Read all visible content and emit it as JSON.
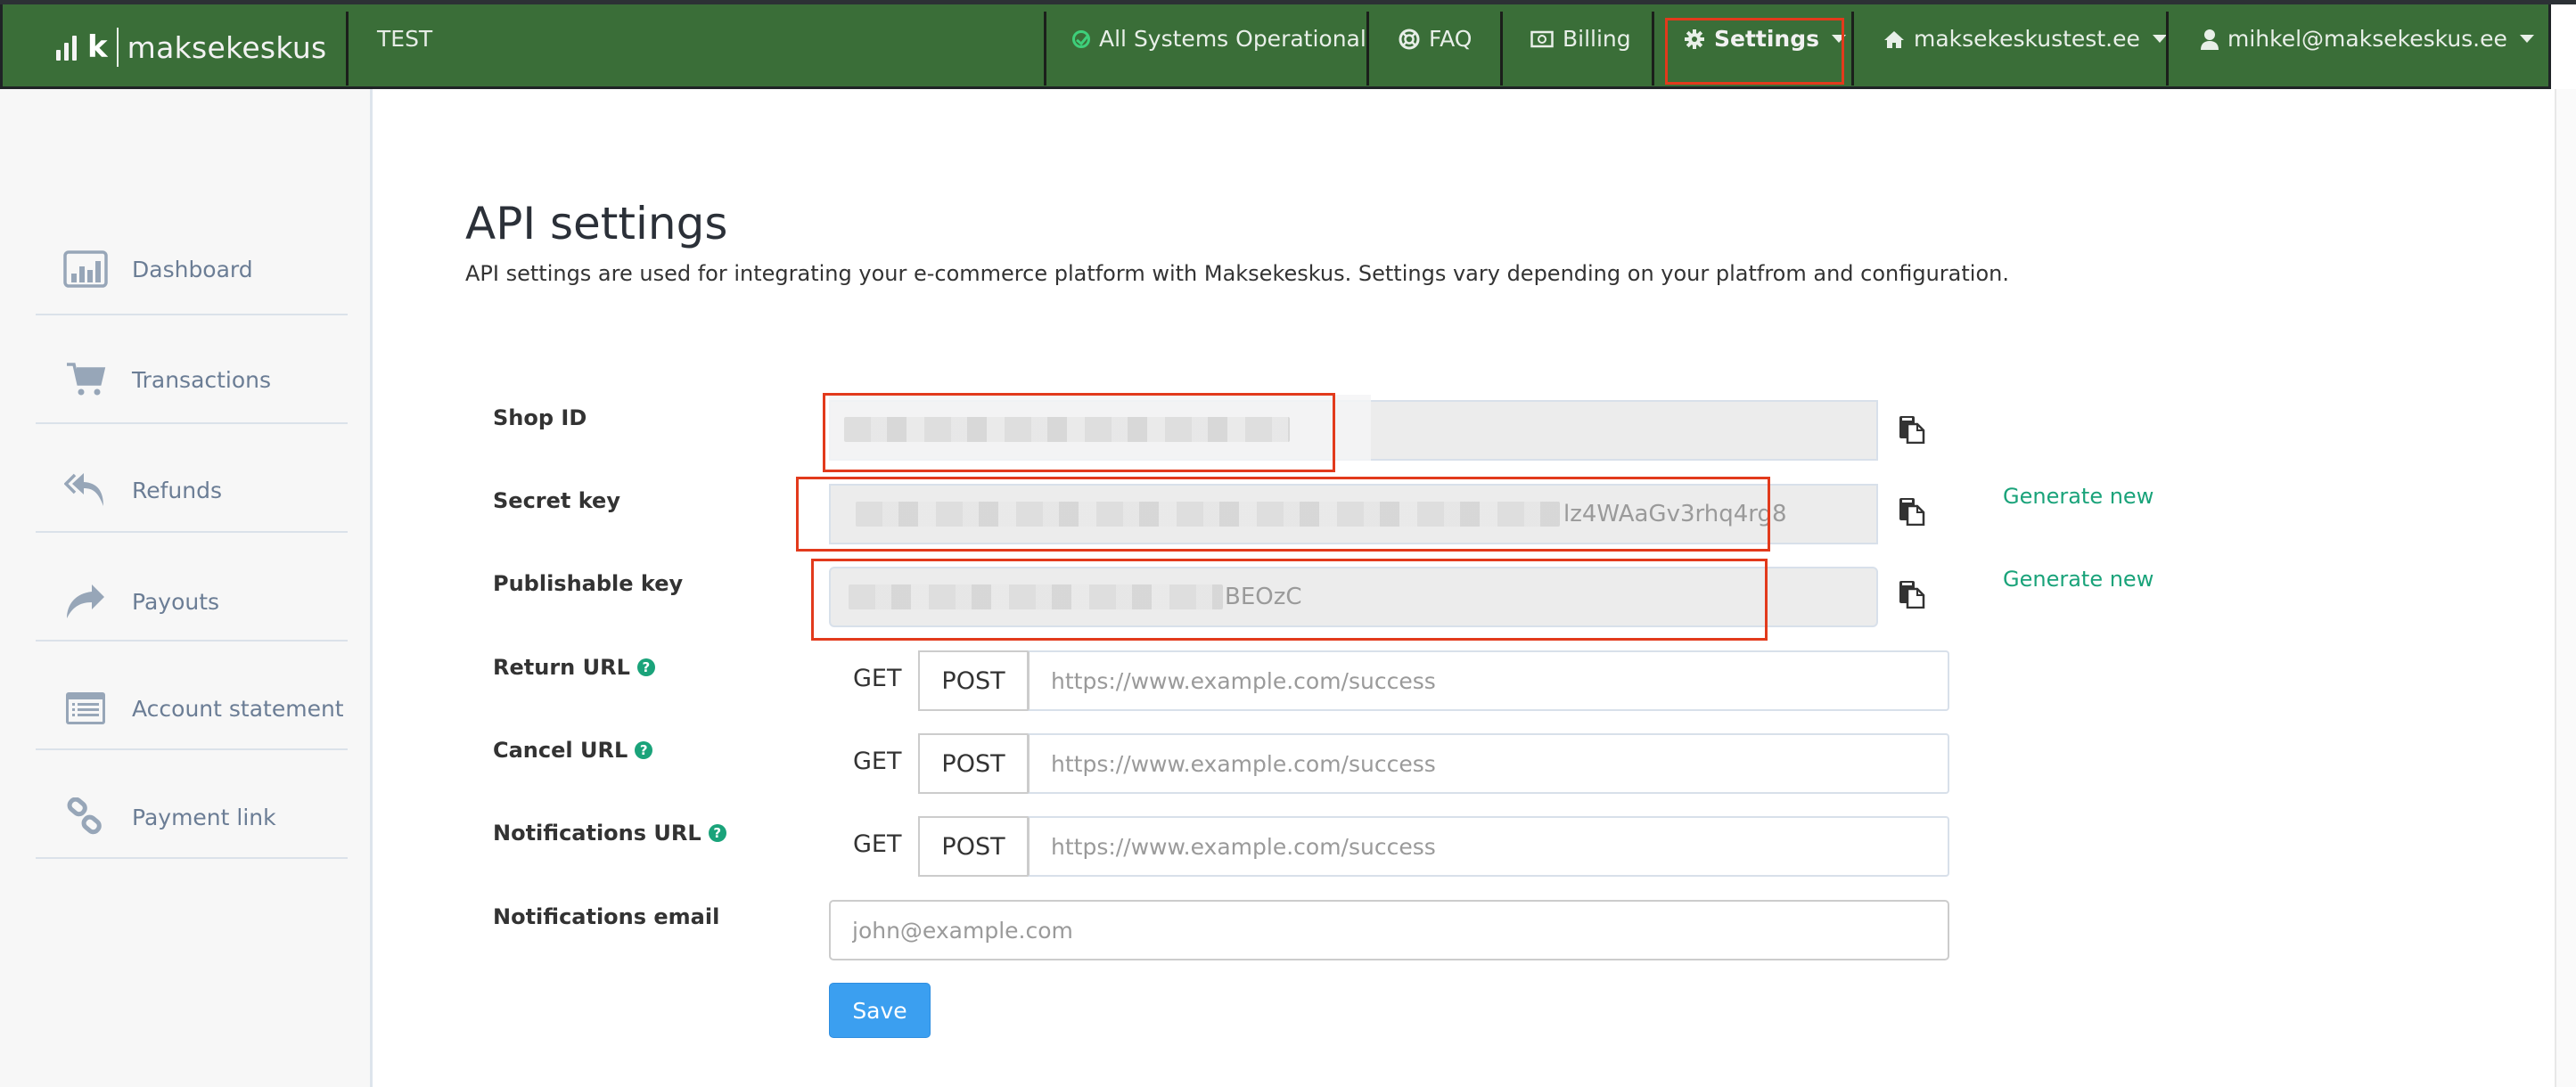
{
  "header": {
    "brand": "maksekeskus",
    "environment": "TEST",
    "status": "All Systems Operational",
    "faq": "FAQ",
    "billing": "Billing",
    "settings": "Settings",
    "shop": "maksekeskustest.ee",
    "user": "mihkel@maksekeskus.ee",
    "colors": {
      "header_bg": "#3a6e38",
      "status_ok": "#3ecf7a",
      "highlight": "#e23a1c"
    }
  },
  "sidebar": {
    "items": [
      {
        "label": "Dashboard",
        "icon": "bar-chart-icon"
      },
      {
        "label": "Transactions",
        "icon": "cart-icon"
      },
      {
        "label": "Refunds",
        "icon": "reply-all-icon"
      },
      {
        "label": "Payouts",
        "icon": "share-icon"
      },
      {
        "label": "Account statement",
        "icon": "list-icon"
      },
      {
        "label": "Payment link",
        "icon": "link-icon"
      }
    ]
  },
  "main": {
    "title": "API settings",
    "description": "API settings are used for integrating your e-commerce platform with Maksekeskus. Settings vary depending on your platfrom and configuration.",
    "fields": {
      "shop_id": {
        "label": "Shop ID",
        "value_visible": ""
      },
      "secret_key": {
        "label": "Secret key",
        "value_visible": "lz4WAaGv3rhq4rg8",
        "generate": "Generate new"
      },
      "publishable_key": {
        "label": "Publishable key",
        "value_visible": "BEOzC",
        "generate": "Generate new"
      }
    },
    "urls": [
      {
        "label": "Return URL",
        "get": "GET",
        "post": "POST",
        "placeholder": "https://www.example.com/success"
      },
      {
        "label": "Cancel URL",
        "get": "GET",
        "post": "POST",
        "placeholder": "https://www.example.com/success"
      },
      {
        "label": "Notifications URL",
        "get": "GET",
        "post": "POST",
        "placeholder": "https://www.example.com/success"
      }
    ],
    "email": {
      "label": "Notifications email",
      "placeholder": "john@example.com"
    },
    "help_glyph": "?",
    "save": "Save"
  }
}
